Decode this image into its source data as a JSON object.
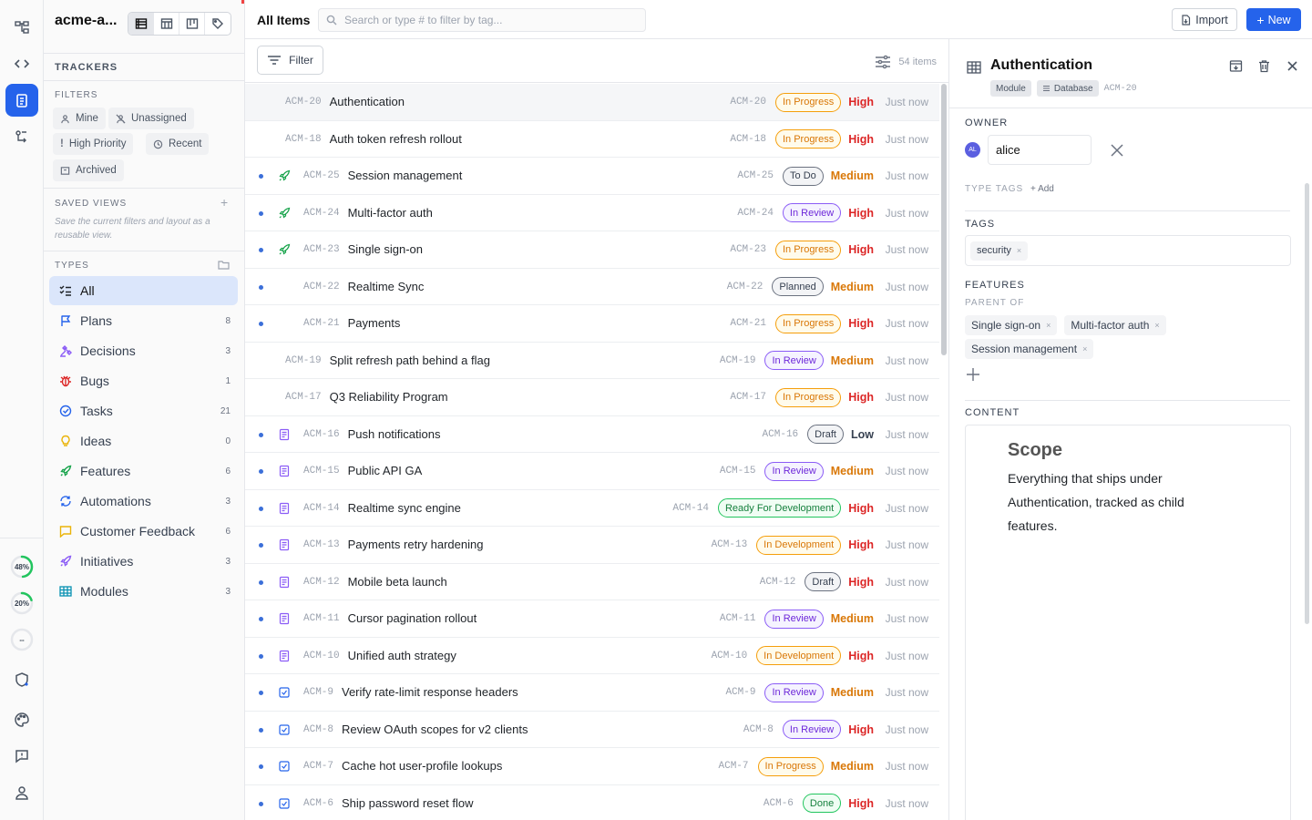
{
  "workspace": {
    "name": "acme-a..."
  },
  "sidebar": {
    "trackers_label": "TRACKERS",
    "filters_label": "FILTERS",
    "filters": [
      {
        "label": "Mine",
        "icon": "user-icon"
      },
      {
        "label": "Unassigned",
        "icon": "user-off-icon"
      },
      {
        "label": "High Priority",
        "icon": "exclamation-icon"
      },
      {
        "label": "Recent",
        "icon": "clock-icon"
      },
      {
        "label": "Archived",
        "icon": "archive-icon"
      }
    ],
    "saved_views_label": "SAVED VIEWS",
    "saved_views_hint": "Save the current filters and layout as a reusable view.",
    "types_label": "TYPES",
    "types": [
      {
        "label": "All",
        "count": ""
      },
      {
        "label": "Plans",
        "count": "8"
      },
      {
        "label": "Decisions",
        "count": "3"
      },
      {
        "label": "Bugs",
        "count": "1"
      },
      {
        "label": "Tasks",
        "count": "21"
      },
      {
        "label": "Ideas",
        "count": "0"
      },
      {
        "label": "Features",
        "count": "6"
      },
      {
        "label": "Automations",
        "count": "3"
      },
      {
        "label": "Customer Feedback",
        "count": "6"
      },
      {
        "label": "Initiatives",
        "count": "3"
      },
      {
        "label": "Modules",
        "count": "3"
      }
    ]
  },
  "rail": {
    "rings": [
      {
        "label": "48%",
        "value": 0.48
      },
      {
        "label": "20%",
        "value": 0.2
      },
      {
        "label": "--",
        "value": 0
      }
    ]
  },
  "header": {
    "title": "All Items",
    "search_placeholder": "Search or type # to filter by tag...",
    "import_label": "Import",
    "new_label": "New"
  },
  "toolbar": {
    "filter_label": "Filter",
    "count": "54 items"
  },
  "items": [
    {
      "id": "ACM-20",
      "name": "Authentication",
      "status": "In Progress",
      "sc": "b-prog",
      "priority": "High",
      "time": "Just now",
      "dot": false,
      "icon": "none",
      "sel": true
    },
    {
      "id": "ACM-18",
      "name": "Auth token refresh rollout",
      "status": "In Progress",
      "sc": "b-prog",
      "priority": "High",
      "time": "Just now",
      "dot": false,
      "icon": "none"
    },
    {
      "id": "ACM-25",
      "name": "Session management",
      "status": "To Do",
      "sc": "b-todo",
      "priority": "Medium",
      "time": "Just now",
      "dot": true,
      "icon": "rocket"
    },
    {
      "id": "ACM-24",
      "name": "Multi-factor auth",
      "status": "In Review",
      "sc": "b-rev",
      "priority": "High",
      "time": "Just now",
      "dot": true,
      "icon": "rocket"
    },
    {
      "id": "ACM-23",
      "name": "Single sign-on",
      "status": "In Progress",
      "sc": "b-prog",
      "priority": "High",
      "time": "Just now",
      "dot": true,
      "icon": "rocket"
    },
    {
      "id": "ACM-22",
      "name": "Realtime Sync",
      "status": "Planned",
      "sc": "b-plan",
      "priority": "Medium",
      "time": "Just now",
      "dot": true,
      "icon": "blank"
    },
    {
      "id": "ACM-21",
      "name": "Payments",
      "status": "In Progress",
      "sc": "b-prog",
      "priority": "High",
      "time": "Just now",
      "dot": true,
      "icon": "blank"
    },
    {
      "id": "ACM-19",
      "name": "Split refresh path behind a flag",
      "status": "In Review",
      "sc": "b-rev",
      "priority": "Medium",
      "time": "Just now",
      "dot": false,
      "icon": "none"
    },
    {
      "id": "ACM-17",
      "name": "Q3 Reliability Program",
      "status": "In Progress",
      "sc": "b-prog",
      "priority": "High",
      "time": "Just now",
      "dot": false,
      "icon": "none"
    },
    {
      "id": "ACM-16",
      "name": "Push notifications",
      "status": "Draft",
      "sc": "b-draft",
      "priority": "Low",
      "time": "Just now",
      "dot": true,
      "icon": "doc"
    },
    {
      "id": "ACM-15",
      "name": "Public API GA",
      "status": "In Review",
      "sc": "b-rev",
      "priority": "Medium",
      "time": "Just now",
      "dot": true,
      "icon": "doc"
    },
    {
      "id": "ACM-14",
      "name": "Realtime sync engine",
      "status": "Ready For Development",
      "sc": "b-ready",
      "priority": "High",
      "time": "Just now",
      "dot": true,
      "icon": "doc"
    },
    {
      "id": "ACM-13",
      "name": "Payments retry hardening",
      "status": "In Development",
      "sc": "b-dev",
      "priority": "High",
      "time": "Just now",
      "dot": true,
      "icon": "doc"
    },
    {
      "id": "ACM-12",
      "name": "Mobile beta launch",
      "status": "Draft",
      "sc": "b-draft",
      "priority": "High",
      "time": "Just now",
      "dot": true,
      "icon": "doc"
    },
    {
      "id": "ACM-11",
      "name": "Cursor pagination rollout",
      "status": "In Review",
      "sc": "b-rev",
      "priority": "Medium",
      "time": "Just now",
      "dot": true,
      "icon": "doc"
    },
    {
      "id": "ACM-10",
      "name": "Unified auth strategy",
      "status": "In Development",
      "sc": "b-dev",
      "priority": "High",
      "time": "Just now",
      "dot": true,
      "icon": "doc"
    },
    {
      "id": "ACM-9",
      "name": "Verify rate-limit response headers",
      "status": "In Review",
      "sc": "b-rev",
      "priority": "Medium",
      "time": "Just now",
      "dot": true,
      "icon": "check"
    },
    {
      "id": "ACM-8",
      "name": "Review OAuth scopes for v2 clients",
      "status": "In Review",
      "sc": "b-rev",
      "priority": "High",
      "time": "Just now",
      "dot": true,
      "icon": "check"
    },
    {
      "id": "ACM-7",
      "name": "Cache hot user-profile lookups",
      "status": "In Progress",
      "sc": "b-prog",
      "priority": "Medium",
      "time": "Just now",
      "dot": true,
      "icon": "check"
    },
    {
      "id": "ACM-6",
      "name": "Ship password reset flow",
      "status": "Done",
      "sc": "b-done",
      "priority": "High",
      "time": "Just now",
      "dot": true,
      "icon": "check"
    }
  ],
  "detail": {
    "title": "Authentication",
    "type_tag": "Module",
    "db_tag": "Database",
    "id": "ACM-20",
    "owner_label": "OWNER",
    "owner_initials": "AL",
    "owner_name": "alice",
    "type_tags_label": "TYPE TAGS",
    "add_label": "+ Add",
    "tags_label": "TAGS",
    "tags": [
      "security"
    ],
    "features_label": "FEATURES",
    "parent_of_label": "PARENT OF",
    "features": [
      "Single sign-on",
      "Multi-factor auth",
      "Session management"
    ],
    "content_label": "CONTENT",
    "content_heading": "Scope",
    "content_body": "Everything that ships under Authentication, tracked as child features."
  },
  "colors": {
    "accent": "#2563eb",
    "high": "#dc2626",
    "medium": "#d97706"
  }
}
